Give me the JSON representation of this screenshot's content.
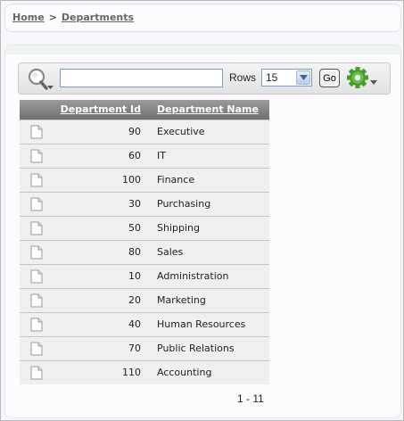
{
  "breadcrumb": {
    "home_label": "Home",
    "separator": ">",
    "current_label": "Departments"
  },
  "search": {
    "value": "",
    "placeholder": "",
    "rows_label": "Rows",
    "rows_value": "15",
    "go_label": "Go",
    "icons": {
      "search": "search-magnifier-dropdown-icon",
      "actions": "gear-actions-menu-icon"
    }
  },
  "table": {
    "columns": [
      "Department Id",
      "Department Name"
    ],
    "rows": [
      {
        "id": "90",
        "name": "Executive"
      },
      {
        "id": "60",
        "name": "IT"
      },
      {
        "id": "100",
        "name": "Finance"
      },
      {
        "id": "30",
        "name": "Purchasing"
      },
      {
        "id": "50",
        "name": "Shipping"
      },
      {
        "id": "80",
        "name": "Sales"
      },
      {
        "id": "10",
        "name": "Administration"
      },
      {
        "id": "20",
        "name": "Marketing"
      },
      {
        "id": "40",
        "name": "Human Resources"
      },
      {
        "id": "70",
        "name": "Public Relations"
      },
      {
        "id": "110",
        "name": "Accounting"
      }
    ]
  },
  "pagination": {
    "range": "1 - 11"
  },
  "colors": {
    "header_bg": "#7f7f7f",
    "row_bg": "#efefef",
    "accent_gear": "#3a8a2a"
  }
}
